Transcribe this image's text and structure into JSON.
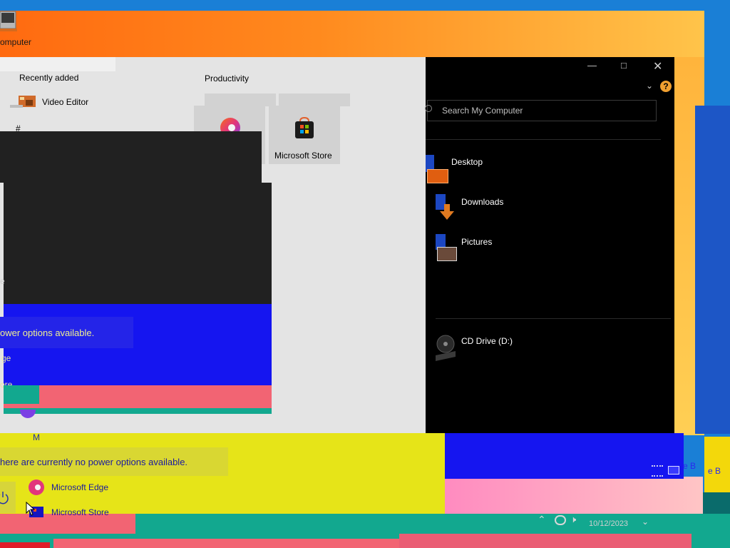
{
  "desktop": {
    "computer_icon_label": "omputer"
  },
  "start_menu": {
    "recently_added_header": "Recently added",
    "recent_item_label": "Video Editor",
    "hash_header": "#",
    "productivity_header": "Productivity",
    "tiles": [
      {
        "label": ""
      },
      {
        "label": "Microsoft Store"
      }
    ],
    "fragment_e": "e",
    "power_message_overlay": "ower options available.",
    "fragment_edge": "ge",
    "fragment_store": "ore",
    "m_header": "M",
    "power_message": "here are currently no power options available.",
    "apps": [
      {
        "label": "Microsoft Edge"
      },
      {
        "label": "Microsoft Store"
      }
    ]
  },
  "explorer": {
    "search_placeholder": "Search My Computer",
    "places": [
      {
        "label": "Desktop"
      },
      {
        "label": "Downloads"
      },
      {
        "label": "Pictures"
      }
    ],
    "drive_label": "CD Drive (D:)",
    "fragment_b1": "e B",
    "fragment_b2": "e B"
  },
  "taskbar": {
    "clock": "10/12/2023"
  },
  "colors": {
    "accent_orange": "#ff6a10",
    "glitch_blue": "#1515f0",
    "glitch_yellow": "#e6e418",
    "glitch_pink": "#f26473",
    "glitch_teal": "#12a88f"
  }
}
